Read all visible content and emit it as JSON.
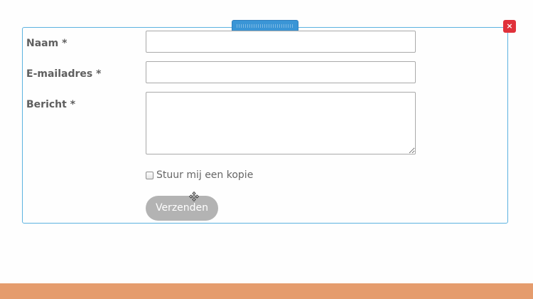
{
  "form": {
    "name_label": "Naam *",
    "name_value": "",
    "email_label": "E-mailadres *",
    "email_value": "",
    "message_label": "Bericht *",
    "message_value": "",
    "copy_checkbox_label": "Stuur mij een kopie",
    "copy_checkbox_checked": false,
    "submit_label": "Verzenden"
  },
  "editor": {
    "delete_label": "×",
    "drag_handle_icon": "grip-icon",
    "cursor_icon": "move-cursor-icon"
  },
  "colors": {
    "frame_border": "#5cb2e0",
    "drag_handle": "#3a95d6",
    "delete_button": "#e0313b",
    "submit_button": "#b3b3b3",
    "footer": "#e59c6d"
  }
}
